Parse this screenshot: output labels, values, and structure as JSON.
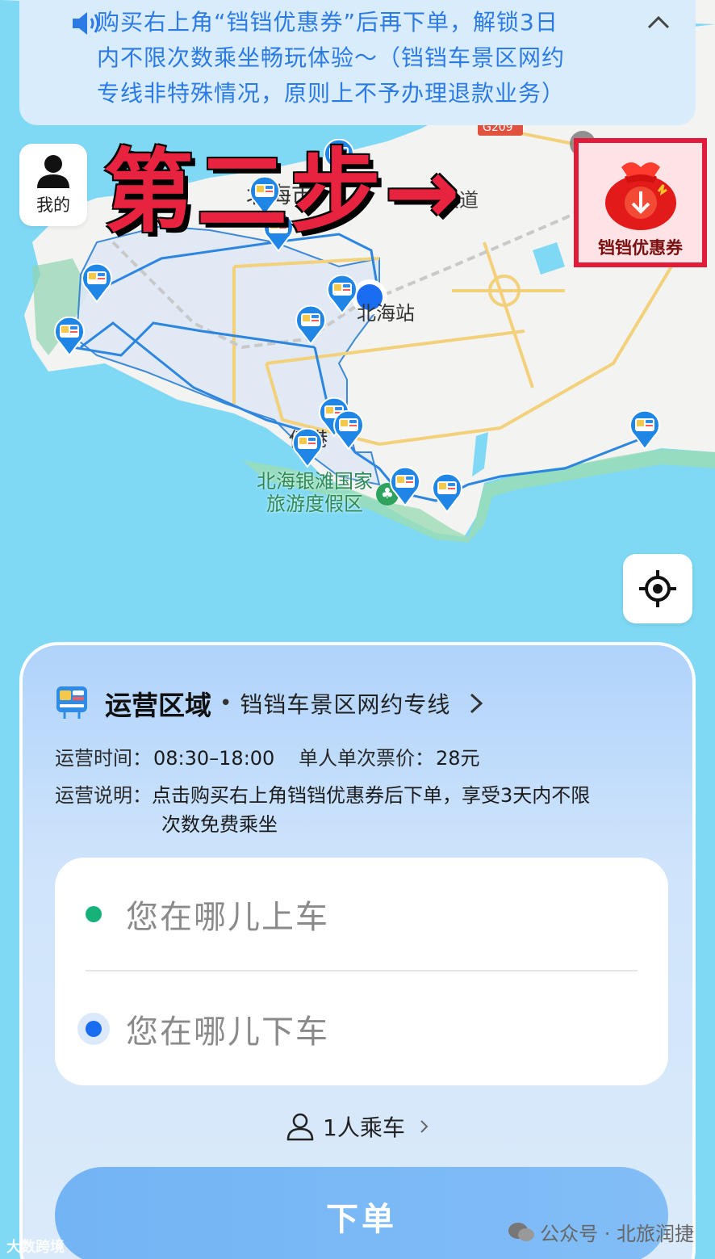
{
  "notice": {
    "text": "购买右上角“铛铛优惠券”后再下单，解锁3日内不限次数乘坐畅玩体验～（铛铛车景区网约专线非特殊情况，原则上不予办理退款业务）",
    "line1": "购买右上角“铛铛优惠券”后再下单，解锁3日",
    "line2": "内不限次数乘坐畅玩体验～（铛铛车景区网约",
    "line3": "专线非特殊情况，原则上不予办理退款业务）"
  },
  "my": {
    "label": "我的"
  },
  "annotation": {
    "text": "第二步→"
  },
  "coupon": {
    "label": "铛铛优惠券"
  },
  "map": {
    "labels": {
      "city": "北海市",
      "avenue": "大道",
      "station": "北海站",
      "road": "G209",
      "qiaogang": "侨港",
      "scenic_line1": "北海银滩国家",
      "scenic_line2": "旅游度假区"
    }
  },
  "panel": {
    "region_title": "运营区域",
    "region_dot": "•",
    "region_name": "铛铛车景区网约专线",
    "time_label": "运营时间：",
    "time_value": "08:30–18:00",
    "price_label": "单人单次票价：",
    "price_value": "28元",
    "desc_label": "运营说明：",
    "desc_line1": "点击购买右上角铛铛优惠券后下单，享受3天内不限",
    "desc_line2": "次数免费乘坐",
    "pickup_placeholder": "您在哪儿上车",
    "dropoff_placeholder": "您在哪儿下车",
    "passengers": "1人乘车",
    "order_button": "下单"
  },
  "watermarks": {
    "right": "公众号 · 北旅润捷",
    "left": "大数跨境"
  },
  "colors": {
    "accent": "#2c7be5",
    "sea": "#7fd9f5",
    "annotation_red": "#e8233f",
    "pickup_dot": "#16b27a",
    "dropoff_dot": "#1a6cf0"
  }
}
